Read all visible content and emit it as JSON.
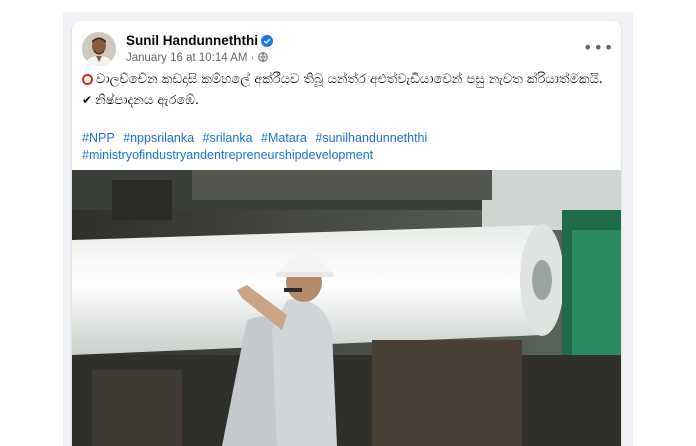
{
  "post": {
    "author": "Sunil Handunneththi",
    "timestamp": "January 16 at 10:14 AM",
    "separator": "·",
    "more_label": "•••",
    "text_line1": "වාලච්චේන කඩදාසි කම්හලේ අක්රීයව තිබූ යන්ත්ර අළුත්වැඩියාවෙන් පසු නැවත ක්රියාත්මකයි.",
    "text_line2": "නිෂ්පාදනය ඇරඹේ.",
    "hashtags": [
      "#NPP",
      "#nppsrilanka",
      "#srilanka",
      "#Matara",
      "#sunilhandunneththi",
      "#ministryofindustryandentrepreneurshipdevelopment"
    ]
  },
  "colors": {
    "link": "#216fdb",
    "verified": "#1877f2",
    "alert": "#e0281b",
    "backdrop": "#f0f2f5"
  },
  "icons": {
    "verified": "verified-badge-icon",
    "audience": "globe-icon",
    "alert": "red-circle-icon",
    "check": "check-mark-icon",
    "more": "more-options-icon"
  }
}
